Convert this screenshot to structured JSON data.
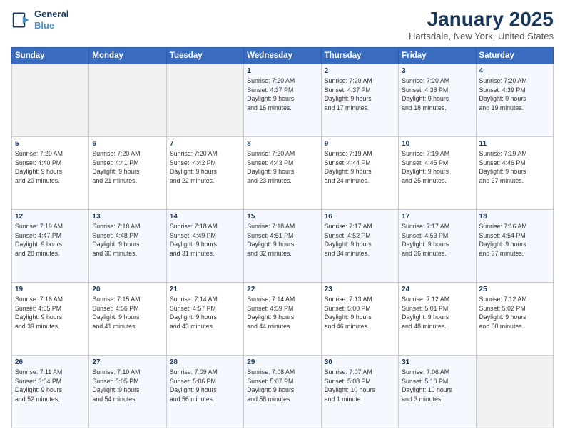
{
  "logo": {
    "line1": "General",
    "line2": "Blue"
  },
  "title": "January 2025",
  "subtitle": "Hartsdale, New York, United States",
  "days_header": [
    "Sunday",
    "Monday",
    "Tuesday",
    "Wednesday",
    "Thursday",
    "Friday",
    "Saturday"
  ],
  "weeks": [
    [
      {
        "day": "",
        "info": ""
      },
      {
        "day": "",
        "info": ""
      },
      {
        "day": "",
        "info": ""
      },
      {
        "day": "1",
        "info": "Sunrise: 7:20 AM\nSunset: 4:37 PM\nDaylight: 9 hours\nand 16 minutes."
      },
      {
        "day": "2",
        "info": "Sunrise: 7:20 AM\nSunset: 4:37 PM\nDaylight: 9 hours\nand 17 minutes."
      },
      {
        "day": "3",
        "info": "Sunrise: 7:20 AM\nSunset: 4:38 PM\nDaylight: 9 hours\nand 18 minutes."
      },
      {
        "day": "4",
        "info": "Sunrise: 7:20 AM\nSunset: 4:39 PM\nDaylight: 9 hours\nand 19 minutes."
      }
    ],
    [
      {
        "day": "5",
        "info": "Sunrise: 7:20 AM\nSunset: 4:40 PM\nDaylight: 9 hours\nand 20 minutes."
      },
      {
        "day": "6",
        "info": "Sunrise: 7:20 AM\nSunset: 4:41 PM\nDaylight: 9 hours\nand 21 minutes."
      },
      {
        "day": "7",
        "info": "Sunrise: 7:20 AM\nSunset: 4:42 PM\nDaylight: 9 hours\nand 22 minutes."
      },
      {
        "day": "8",
        "info": "Sunrise: 7:20 AM\nSunset: 4:43 PM\nDaylight: 9 hours\nand 23 minutes."
      },
      {
        "day": "9",
        "info": "Sunrise: 7:19 AM\nSunset: 4:44 PM\nDaylight: 9 hours\nand 24 minutes."
      },
      {
        "day": "10",
        "info": "Sunrise: 7:19 AM\nSunset: 4:45 PM\nDaylight: 9 hours\nand 25 minutes."
      },
      {
        "day": "11",
        "info": "Sunrise: 7:19 AM\nSunset: 4:46 PM\nDaylight: 9 hours\nand 27 minutes."
      }
    ],
    [
      {
        "day": "12",
        "info": "Sunrise: 7:19 AM\nSunset: 4:47 PM\nDaylight: 9 hours\nand 28 minutes."
      },
      {
        "day": "13",
        "info": "Sunrise: 7:18 AM\nSunset: 4:48 PM\nDaylight: 9 hours\nand 30 minutes."
      },
      {
        "day": "14",
        "info": "Sunrise: 7:18 AM\nSunset: 4:49 PM\nDaylight: 9 hours\nand 31 minutes."
      },
      {
        "day": "15",
        "info": "Sunrise: 7:18 AM\nSunset: 4:51 PM\nDaylight: 9 hours\nand 32 minutes."
      },
      {
        "day": "16",
        "info": "Sunrise: 7:17 AM\nSunset: 4:52 PM\nDaylight: 9 hours\nand 34 minutes."
      },
      {
        "day": "17",
        "info": "Sunrise: 7:17 AM\nSunset: 4:53 PM\nDaylight: 9 hours\nand 36 minutes."
      },
      {
        "day": "18",
        "info": "Sunrise: 7:16 AM\nSunset: 4:54 PM\nDaylight: 9 hours\nand 37 minutes."
      }
    ],
    [
      {
        "day": "19",
        "info": "Sunrise: 7:16 AM\nSunset: 4:55 PM\nDaylight: 9 hours\nand 39 minutes."
      },
      {
        "day": "20",
        "info": "Sunrise: 7:15 AM\nSunset: 4:56 PM\nDaylight: 9 hours\nand 41 minutes."
      },
      {
        "day": "21",
        "info": "Sunrise: 7:14 AM\nSunset: 4:57 PM\nDaylight: 9 hours\nand 43 minutes."
      },
      {
        "day": "22",
        "info": "Sunrise: 7:14 AM\nSunset: 4:59 PM\nDaylight: 9 hours\nand 44 minutes."
      },
      {
        "day": "23",
        "info": "Sunrise: 7:13 AM\nSunset: 5:00 PM\nDaylight: 9 hours\nand 46 minutes."
      },
      {
        "day": "24",
        "info": "Sunrise: 7:12 AM\nSunset: 5:01 PM\nDaylight: 9 hours\nand 48 minutes."
      },
      {
        "day": "25",
        "info": "Sunrise: 7:12 AM\nSunset: 5:02 PM\nDaylight: 9 hours\nand 50 minutes."
      }
    ],
    [
      {
        "day": "26",
        "info": "Sunrise: 7:11 AM\nSunset: 5:04 PM\nDaylight: 9 hours\nand 52 minutes."
      },
      {
        "day": "27",
        "info": "Sunrise: 7:10 AM\nSunset: 5:05 PM\nDaylight: 9 hours\nand 54 minutes."
      },
      {
        "day": "28",
        "info": "Sunrise: 7:09 AM\nSunset: 5:06 PM\nDaylight: 9 hours\nand 56 minutes."
      },
      {
        "day": "29",
        "info": "Sunrise: 7:08 AM\nSunset: 5:07 PM\nDaylight: 9 hours\nand 58 minutes."
      },
      {
        "day": "30",
        "info": "Sunrise: 7:07 AM\nSunset: 5:08 PM\nDaylight: 10 hours\nand 1 minute."
      },
      {
        "day": "31",
        "info": "Sunrise: 7:06 AM\nSunset: 5:10 PM\nDaylight: 10 hours\nand 3 minutes."
      },
      {
        "day": "",
        "info": ""
      }
    ]
  ]
}
